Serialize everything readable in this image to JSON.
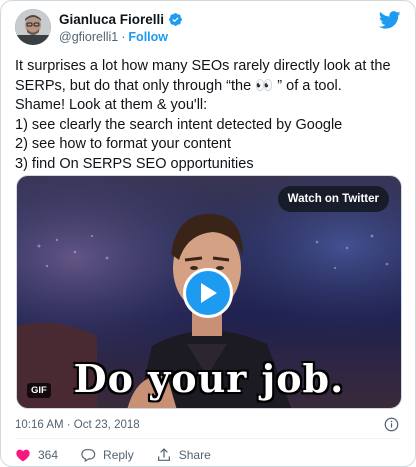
{
  "header": {
    "name": "Gianluca Fiorelli",
    "handle": "@gfiorelli1",
    "separator": "·",
    "follow_label": "Follow"
  },
  "tweet": {
    "lines": [
      "It surprises a lot how many SEOs rarely directly look at the",
      "SERPs, but do that only through “the 👀 ” of a tool.",
      "Shame! Look at them & you'll:",
      "1) see clearly the search intent detected by Google",
      "2) see how to format your content",
      "3) find On SERPS SEO opportunities"
    ]
  },
  "media": {
    "watch_label": "Watch on Twitter",
    "caption": "Do your job.",
    "gif_badge": "GIF"
  },
  "meta": {
    "timestamp": "10:16 AM · Oct 23, 2018"
  },
  "actions": {
    "like_count": "364",
    "reply_label": "Reply",
    "share_label": "Share"
  },
  "colors": {
    "accent": "#1d9bf0",
    "like": "#f91880",
    "text": "#0f1419",
    "secondary": "#536471"
  }
}
